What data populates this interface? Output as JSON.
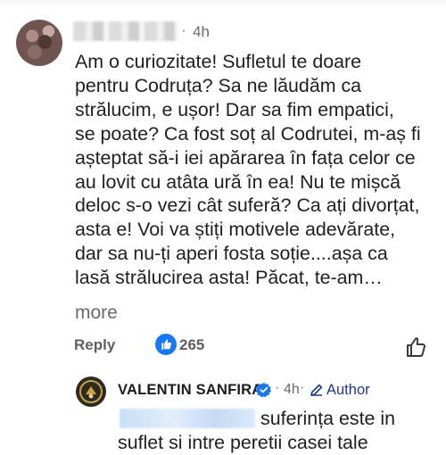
{
  "comment": {
    "time": "4h",
    "separator": "·",
    "lines": [
      "Am o curiozitate! Sufletul te doare",
      "pentru Codruța? Sa ne lăudăm ca",
      "strălucim,  e ușor! Dar sa fim empatici,",
      "se poate? Ca fost soț al Codrutei, m-aș fi",
      "așteptat să-i iei apărarea în fața celor ce",
      "au lovit cu atâta ură în ea! Nu te mișcă",
      "deloc s-o vezi cât suferă? Ca ați divorțat,",
      "asta e! Voi va știți motivele adevărate,",
      "dar sa nu-ți aperi fosta soție....așa  ca",
      "lasă strălucirea asta! Păcat, te-am…"
    ],
    "more_label": "more",
    "reply_label": "Reply",
    "like_count": "265"
  },
  "reply": {
    "author_name": "VALENTIN SANFIRA",
    "time": "4h",
    "separator": "·",
    "author_badge": "Author",
    "lines": [
      "suferința este in",
      "suflet si intre peretii casei tale"
    ]
  },
  "icons": {
    "like_reaction": "thumbs-up-icon",
    "like_button": "thumbs-up-outline-icon",
    "verified": "verified-check-icon",
    "author": "pencil-icon"
  },
  "colors": {
    "facebook_blue": "#1877f2",
    "author_tag": "#1f3a8a",
    "secondary_text": "#6b6b6b"
  }
}
